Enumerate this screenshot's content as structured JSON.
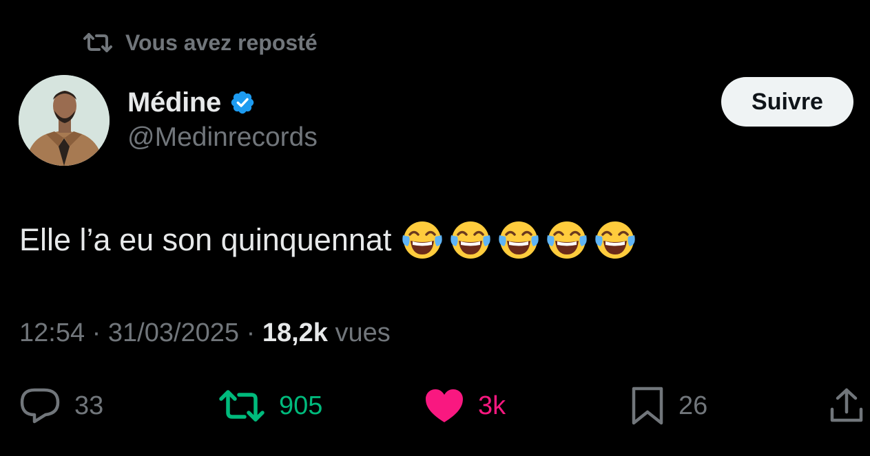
{
  "repost_banner": {
    "text": "Vous avez reposté",
    "icon": "repost-icon"
  },
  "author": {
    "name": "Médine",
    "handle": "@Medinrecords",
    "verified": true,
    "avatar_icon": "avatar"
  },
  "follow_button": {
    "label": "Suivre"
  },
  "tweet": {
    "text": "Elle l’a eu son quinquennat",
    "emoji": [
      "face-with-tears-of-joy",
      "face-with-tears-of-joy",
      "face-with-tears-of-joy",
      "face-with-tears-of-joy",
      "face-with-tears-of-joy"
    ]
  },
  "meta": {
    "time": "12:54",
    "separator": "·",
    "date": "31/03/2025",
    "views_count": "18,2k",
    "views_label": "vues"
  },
  "actions": {
    "replies": "33",
    "reposts": "905",
    "likes": "3k",
    "bookmarks": "26"
  },
  "colors": {
    "background": "#000000",
    "text_primary": "#e7e9ea",
    "text_secondary": "#71767b",
    "verified": "#1d9bf0",
    "repost_active": "#00ba7c",
    "like_active": "#f91880",
    "button_bg": "#eff3f4"
  }
}
